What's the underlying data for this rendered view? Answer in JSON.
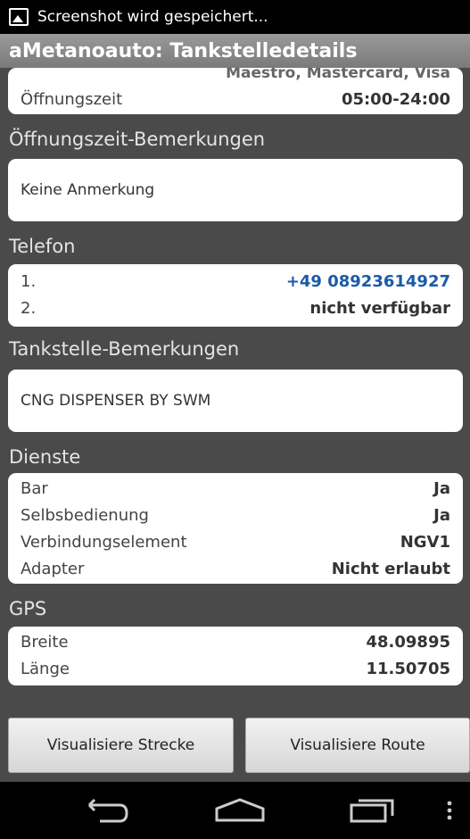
{
  "status_bar": {
    "text": "Screenshot wird gespeichert..."
  },
  "app": {
    "title": "aMetanoauto: Tankstelledetails"
  },
  "payment": {
    "cut_text": "Maestro, Mastercard, Visa"
  },
  "opening": {
    "label": "Öffnungszeit",
    "value": "05:00-24:00"
  },
  "opening_notes": {
    "title": "Öffnungszeit-Bemerkungen",
    "text": "Keine Anmerkung"
  },
  "phone": {
    "title": "Telefon",
    "rows": [
      {
        "label": "1.",
        "value": "+49 08923614927"
      },
      {
        "label": "2.",
        "value": "nicht verfügbar"
      }
    ]
  },
  "station_notes": {
    "title": "Tankstelle-Bemerkungen",
    "text": "CNG DISPENSER BY SWM"
  },
  "services": {
    "title": "Dienste",
    "rows": [
      {
        "label": "Bar",
        "value": "Ja"
      },
      {
        "label": "Selbsbedienung",
        "value": "Ja"
      },
      {
        "label": "Verbindungselement",
        "value": "NGV1"
      },
      {
        "label": "Adapter",
        "value": "Nicht erlaubt"
      }
    ]
  },
  "gps": {
    "title": "GPS",
    "rows": [
      {
        "label": "Breite",
        "value": "48.09895"
      },
      {
        "label": "Länge",
        "value": "11.50705"
      }
    ]
  },
  "buttons": {
    "route_line": "Visualisiere Strecke",
    "route": "Visualisiere Route"
  },
  "icons": {
    "status": "image-icon",
    "back": "back-icon",
    "home": "home-icon",
    "recents": "recents-icon",
    "menu": "overflow-menu-icon"
  }
}
